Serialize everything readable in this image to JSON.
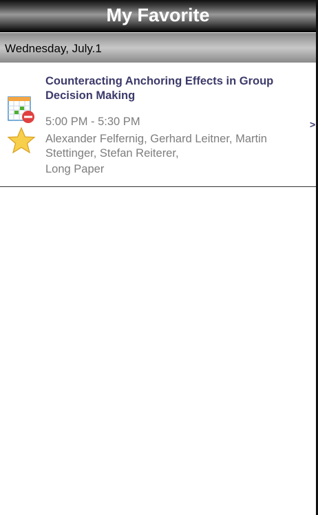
{
  "header": {
    "title": "My Favorite"
  },
  "day": {
    "label": "Wednesday, July.1"
  },
  "sessions": [
    {
      "title": "Counteracting Anchoring Effects in Group Decision Making",
      "time": "5:00 PM - 5:30 PM",
      "authors": "Alexander Felfernig, Gerhard Leitner, Martin Stettinger, Stefan Reiterer,",
      "type": "Long Paper",
      "icons": [
        "calendar-remove-icon",
        "star-icon"
      ],
      "chevron": ">"
    }
  ],
  "colors": {
    "title": "#3c3a6a",
    "meta": "#7d7d7d",
    "star": "#f5c842",
    "remove": "#e04040"
  }
}
